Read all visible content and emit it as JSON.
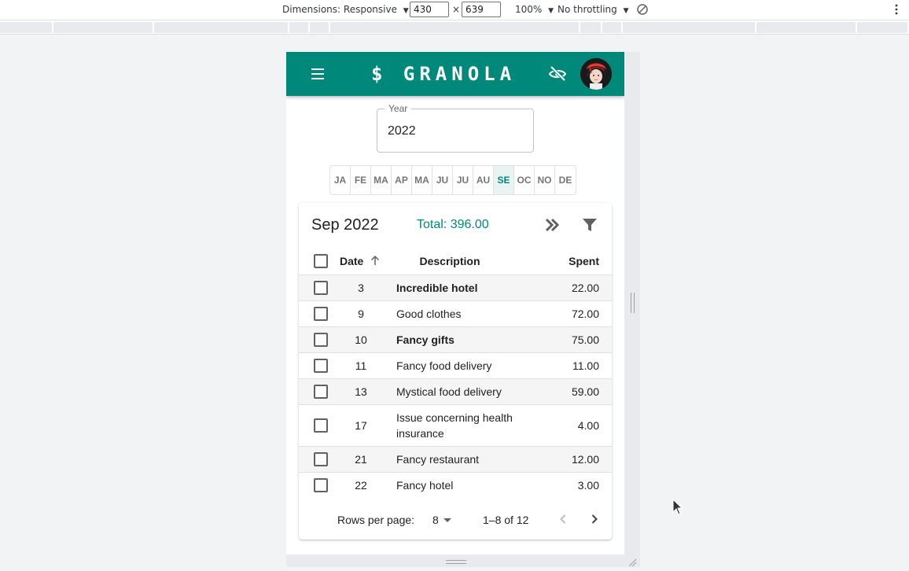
{
  "devtools": {
    "dimensions_label": "Dimensions: Responsive",
    "width": "430",
    "times": "×",
    "height": "639",
    "zoom": "100%",
    "throttling": "No throttling",
    "more_icon": "kebab-icon"
  },
  "app": {
    "title": "$ GRANOLA",
    "brand_color": "#00897b",
    "menu_icon": "hamburger-icon",
    "privacy_icon": "eye-off-icon",
    "avatar_icon": "user-avatar"
  },
  "year_field": {
    "label": "Year",
    "value": "2022"
  },
  "months": [
    {
      "label": "JA",
      "selected": false
    },
    {
      "label": "FE",
      "selected": false
    },
    {
      "label": "MA",
      "selected": false
    },
    {
      "label": "AP",
      "selected": false
    },
    {
      "label": "MA",
      "selected": false
    },
    {
      "label": "JU",
      "selected": false
    },
    {
      "label": "JU",
      "selected": false
    },
    {
      "label": "AU",
      "selected": false
    },
    {
      "label": "SE",
      "selected": true
    },
    {
      "label": "OC",
      "selected": false
    },
    {
      "label": "NO",
      "selected": false
    },
    {
      "label": "DE",
      "selected": false
    }
  ],
  "card": {
    "title": "Sep 2022",
    "total": "Total: 396.00",
    "forward_icon": "double-chevron-right-icon",
    "filter_icon": "filter-icon"
  },
  "table": {
    "headers": {
      "date": "Date",
      "description": "Description",
      "spent": "Spent"
    },
    "sort_icon": "arrow-up-icon",
    "rows": [
      {
        "date": "3",
        "description": "Incredible hotel",
        "spent": "22.00",
        "bold": true
      },
      {
        "date": "9",
        "description": "Good clothes",
        "spent": "72.00",
        "bold": false
      },
      {
        "date": "10",
        "description": "Fancy gifts",
        "spent": "75.00",
        "bold": true
      },
      {
        "date": "11",
        "description": "Fancy food delivery",
        "spent": "11.00",
        "bold": false
      },
      {
        "date": "13",
        "description": "Mystical food delivery",
        "spent": "59.00",
        "bold": false
      },
      {
        "date": "17",
        "description": "Issue concerning health insurance",
        "spent": "4.00",
        "bold": false
      },
      {
        "date": "21",
        "description": "Fancy restaurant",
        "spent": "12.00",
        "bold": false
      },
      {
        "date": "22",
        "description": "Fancy hotel",
        "spent": "3.00",
        "bold": false
      }
    ]
  },
  "pagination": {
    "rows_per_page_label": "Rows per page:",
    "rows_per_page_value": "8",
    "range": "1–8 of 12"
  }
}
